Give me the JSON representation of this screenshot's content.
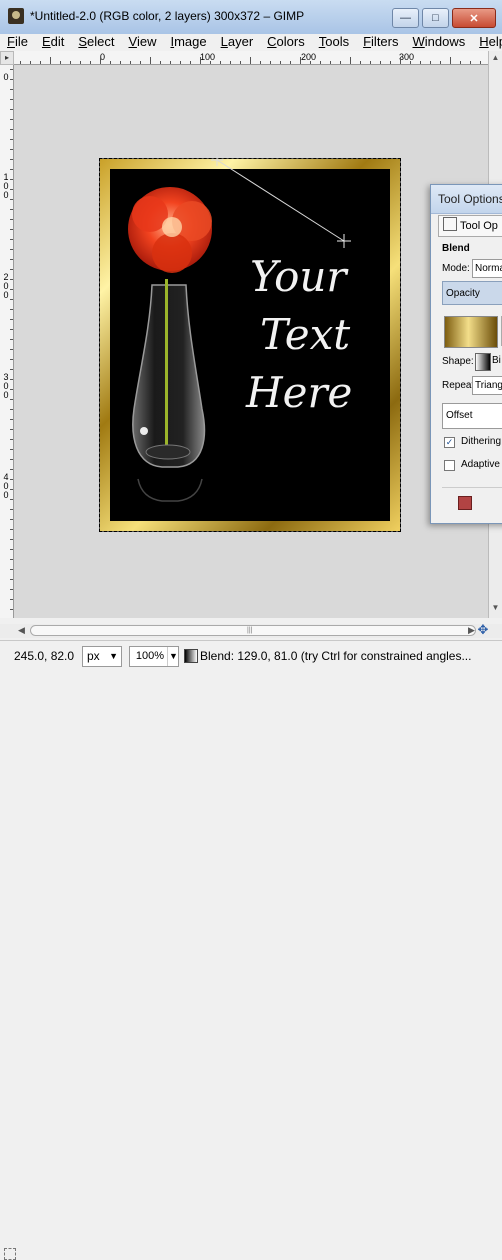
{
  "window": {
    "title": "*Untitled-2.0 (RGB color, 2 layers) 300x372 – GIMP",
    "minimize_icon": "minimize-icon",
    "maximize_icon": "maximize-icon",
    "close_icon": "close-icon"
  },
  "menu": [
    "File",
    "Edit",
    "Select",
    "View",
    "Image",
    "Layer",
    "Colors",
    "Tools",
    "Filters",
    "Windows",
    "Help"
  ],
  "rulers": {
    "top_labels": [
      "0",
      "100",
      "200",
      "300"
    ],
    "left_labels": [
      "0",
      "100",
      "200",
      "300",
      "400"
    ]
  },
  "canvas": {
    "text_line1": "Your",
    "text_line2": "Text",
    "text_line3": "Here",
    "text_color": "#f2f2f2",
    "background_color": "#000000"
  },
  "statusbar": {
    "coords": "245.0, 82.0",
    "unit": "px",
    "zoom": "100%",
    "message": "Blend: 129.0, 81.0 (try Ctrl for constrained angles..."
  },
  "tool_options": {
    "title": "Tool Options",
    "tab_label": "Tool Op",
    "heading": "Blend",
    "mode_label": "Mode:",
    "mode_value": "Norma",
    "opacity_label": "Opacity",
    "shape_label": "Shape:",
    "shape_value": "Bi",
    "repeat_label": "Repeat:",
    "repeat_value": "Triang",
    "offset_label": "Offset",
    "dithering_label": "Dithering",
    "dithering_checked": true,
    "adaptive_label": "Adaptive",
    "adaptive_checked": false
  }
}
